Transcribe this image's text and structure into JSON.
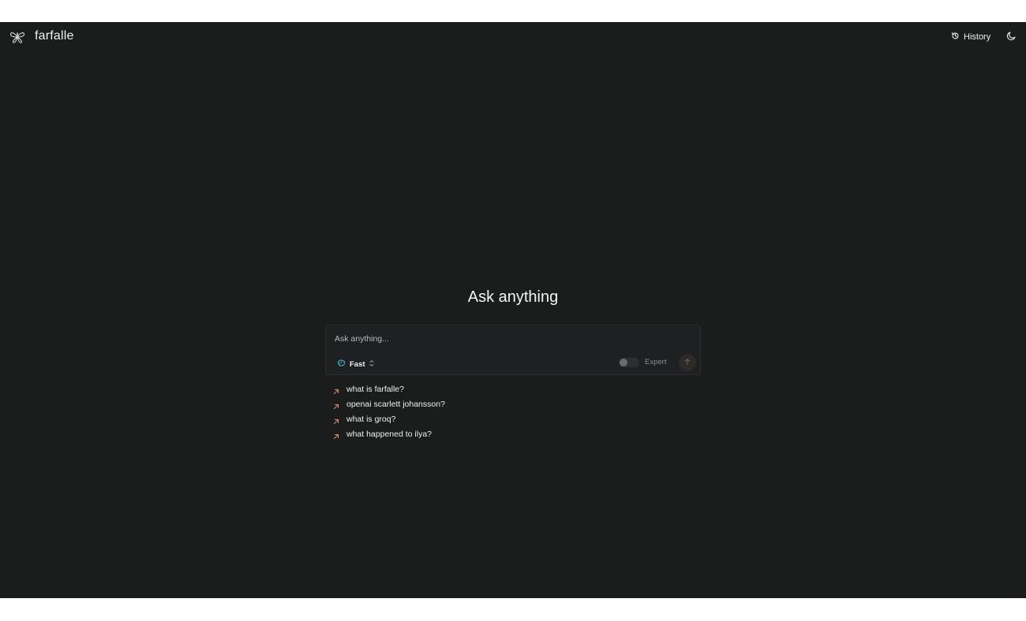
{
  "header": {
    "brand": "farfalle",
    "history_label": "History",
    "logo_icon": "butterfly-icon",
    "history_icon": "history-icon",
    "theme_icon": "moon-icon"
  },
  "main": {
    "title": "Ask anything",
    "input_placeholder": "Ask anything...",
    "input_value": "",
    "model_label": "Fast",
    "expert_label": "Expert",
    "expert_enabled": false
  },
  "suggestions": [
    {
      "text": "what is farfalle?"
    },
    {
      "text": "openai scarlett johansson?"
    },
    {
      "text": "what is groq?"
    },
    {
      "text": "what happened to ilya?"
    }
  ],
  "colors": {
    "background": "#1b1c1c",
    "accent_arrow": "#e08a6b",
    "model_icon": "#3fbfd0"
  }
}
